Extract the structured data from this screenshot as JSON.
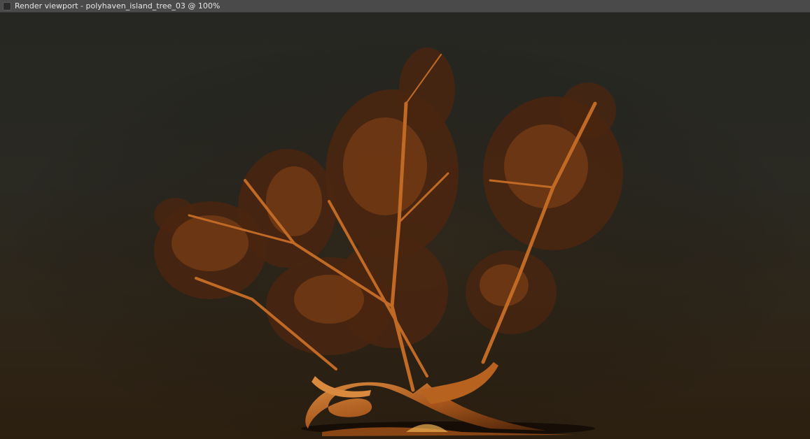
{
  "window": {
    "title": "Render viewport - polyhaven_island_tree_03 @ 100%"
  },
  "render": {
    "subject": "tree-render",
    "colors": {
      "sky_top": "#262722",
      "ground": "#2c1f10",
      "trunk": "#b8621f",
      "trunk_highlight": "#e08a35",
      "foliage": "#5a2e10",
      "foliage_lit": "#a9561c"
    }
  }
}
